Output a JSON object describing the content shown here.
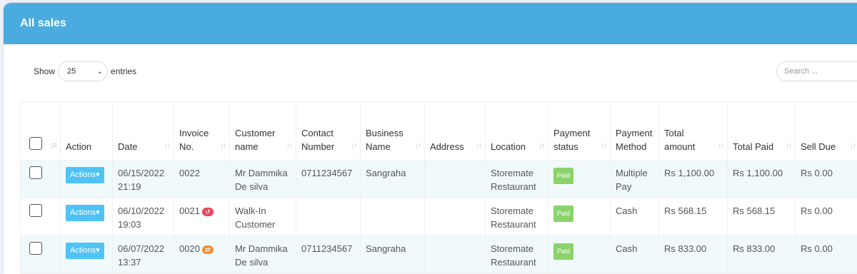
{
  "header": {
    "title": "All sales"
  },
  "length": {
    "show_label": "Show",
    "value": "25",
    "entries_label": "entries"
  },
  "search": {
    "placeholder": "Search ..."
  },
  "table": {
    "columns": {
      "action": "Action",
      "date": "Date",
      "invoice": [
        "Invoice",
        "No."
      ],
      "customer": [
        "Customer",
        "name"
      ],
      "contact": [
        "Contact",
        "Number"
      ],
      "business": [
        "Business",
        "Name"
      ],
      "address": "Address",
      "location": "Location",
      "payment_status": [
        "Payment",
        "status"
      ],
      "payment_method": [
        "Payment",
        "Method"
      ],
      "total_amount": [
        "Total",
        "amount"
      ],
      "total_paid": "Total Paid",
      "sell_due": "Sell Due"
    },
    "rows": [
      {
        "action": "Actions",
        "date": [
          "06/15/2022",
          "21:19"
        ],
        "invoice": "0022",
        "invoice_icon": "",
        "customer": [
          "Mr Dammika",
          "De silva"
        ],
        "contact": "0711234567",
        "business": "Sangraha",
        "address": "",
        "location": [
          "Storemate",
          "Restaurant"
        ],
        "payment_status": "Paid",
        "payment_method": [
          "Multiple",
          "Pay"
        ],
        "total_amount": "Rs 1,100.00",
        "total_paid": "Rs 1,100.00",
        "sell_due": "Rs 0.00"
      },
      {
        "action": "Actions",
        "date": [
          "06/10/2022",
          "19:03"
        ],
        "invoice": "0021",
        "invoice_icon": "undo-icon",
        "customer": [
          "Walk-In",
          "Customer"
        ],
        "contact": "",
        "business": "",
        "address": "",
        "location": [
          "Storemate",
          "Restaurant"
        ],
        "payment_status": "Paid",
        "payment_method": [
          "Cash",
          ""
        ],
        "total_amount": "Rs 568.15",
        "total_paid": "Rs 568.15",
        "sell_due": "Rs 0.00"
      },
      {
        "action": "Actions",
        "date": [
          "06/07/2022",
          "13:37"
        ],
        "invoice": "0020",
        "invoice_icon": "exchange-icon",
        "customer": [
          "Mr Dammika",
          "De silva"
        ],
        "contact": "0711234567",
        "business": "Sangraha",
        "address": "",
        "location": [
          "Storemate",
          "Restaurant"
        ],
        "payment_status": "Paid",
        "payment_method": [
          "Cash",
          ""
        ],
        "total_amount": "Rs 833.00",
        "total_paid": "Rs 833.00",
        "sell_due": "Rs 0.00"
      }
    ]
  },
  "colors": {
    "header_bg": "#4aabdf",
    "actions_btn": "#4fc3f7",
    "paid_badge": "#8bd36a",
    "return_red": "#e8445b",
    "return_orange": "#f0913a"
  }
}
